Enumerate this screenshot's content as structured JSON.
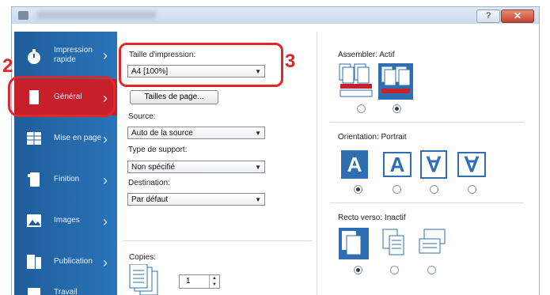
{
  "window": {
    "close_glyph": "✕",
    "help_glyph": "?"
  },
  "sidebar": {
    "items": [
      {
        "label": "Impression rapide",
        "icon": "stopwatch-icon"
      },
      {
        "label": "Général",
        "icon": "page-icon"
      },
      {
        "label": "Mise en page",
        "icon": "layout-icon"
      },
      {
        "label": "Finition",
        "icon": "finishing-icon"
      },
      {
        "label": "Images",
        "icon": "images-icon"
      },
      {
        "label": "Publication",
        "icon": "publication-icon"
      },
      {
        "label": "Travail",
        "icon": "job-icon"
      }
    ],
    "chevron": "›"
  },
  "callouts": {
    "two": "2",
    "three": "3"
  },
  "general": {
    "print_size_label": "Taille d'impression:",
    "print_size_value": "A4 [100%]",
    "page_sizes_button": "Tailles de page...",
    "source_label": "Source:",
    "source_value": "Auto de la source",
    "media_type_label": "Type de support:",
    "media_type_value": "Non spécifié",
    "destination_label": "Destination:",
    "destination_value": "Par défaut",
    "copies_label": "Copies:",
    "copies_value": "1",
    "dropdown_arrow": "▼"
  },
  "collate": {
    "label": "Assembler: Actif"
  },
  "orientation": {
    "label": "Orientation: Portrait",
    "glyph_up": "A",
    "glyph_down": "∀"
  },
  "duplex": {
    "label": "Recto verso: Inactif"
  },
  "colors": {
    "sidebar": "#2a74b8",
    "active": "#c8202a",
    "callout": "#e02828",
    "accent": "#2f6fb1"
  }
}
